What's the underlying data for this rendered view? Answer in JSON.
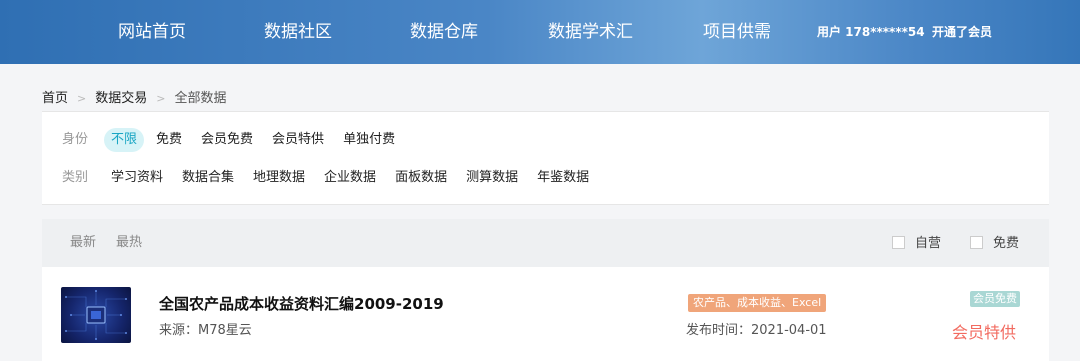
{
  "nav": {
    "items": [
      "网站首页",
      "数据社区",
      "数据仓库",
      "数据学术汇",
      "项目供需"
    ],
    "user_label": "用户 178******54",
    "member_link": "开通了会员"
  },
  "breadcrumb": {
    "items": [
      "首页",
      "数据交易"
    ],
    "current": "全部数据"
  },
  "filters": {
    "identity": {
      "label": "身份",
      "options": [
        "不限",
        "免费",
        "会员免费",
        "会员特供",
        "单独付费"
      ],
      "selected": "不限"
    },
    "category": {
      "label": "类别",
      "options": [
        "学习资料",
        "数据合集",
        "地理数据",
        "企业数据",
        "面板数据",
        "测算数据",
        "年鉴数据"
      ]
    }
  },
  "sort": {
    "options": [
      "最新",
      "最热"
    ],
    "checkboxes": [
      "自营",
      "免费"
    ]
  },
  "items": [
    {
      "title": "全国农产品成本收益资料汇编2009-2019",
      "source": "来源：M78星云",
      "tags": "农产品、成本收益、Excel",
      "published": "发布时间：2021-04-01",
      "badge": "会员免费",
      "price_label": "会员特供"
    }
  ],
  "colors": {
    "nav_gradient_start": "#2f6fb3",
    "nav_gradient_mid": "#6ea5d8",
    "active_filter_bg": "#d7f3f7",
    "active_filter_text": "#1aa6c4",
    "tag_bg": "#f0a57a",
    "badge_bg": "#a9d7d4",
    "price_text": "#f26b60"
  }
}
